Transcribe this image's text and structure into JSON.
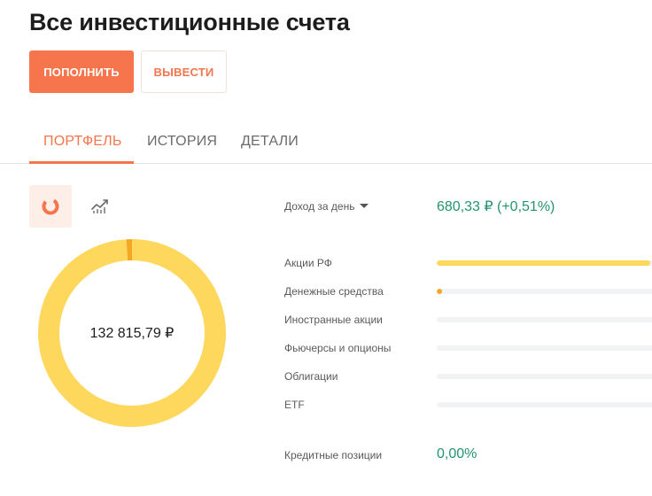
{
  "header": {
    "title": "Все инвестиционные счета"
  },
  "actions": {
    "deposit_label": "ПОПОЛНИТЬ",
    "withdraw_label": "ВЫВЕСТИ"
  },
  "tabs": [
    {
      "label": "ПОРТФЕЛЬ",
      "active": true
    },
    {
      "label": "ИСТОРИЯ",
      "active": false
    },
    {
      "label": "ДЕТАЛИ",
      "active": false
    }
  ],
  "view_toggles": [
    {
      "icon": "donut-chart-icon",
      "active": true
    },
    {
      "icon": "line-chart-icon",
      "active": false
    }
  ],
  "portfolio": {
    "total": "132 815,79 ₽"
  },
  "daily_income": {
    "label": "Доход за день",
    "value": "680,33 ₽ (+0,51%)"
  },
  "allocation": [
    {
      "label": "Акции РФ",
      "share": 0.99,
      "color": "#fdd85d"
    },
    {
      "label": "Денежные средства",
      "share": 0.01,
      "color": "#f5a623"
    },
    {
      "label": "Иностранные акции",
      "share": 0,
      "color": "#fdd85d"
    },
    {
      "label": "Фьючерсы и опционы",
      "share": 0,
      "color": "#fdd85d"
    },
    {
      "label": "Облигации",
      "share": 0,
      "color": "#fdd85d"
    },
    {
      "label": "ETF",
      "share": 0,
      "color": "#fdd85d"
    }
  ],
  "credit": {
    "label": "Кредитные позиции",
    "value": "0,00%"
  },
  "colors": {
    "accent": "#f7754c",
    "positive": "#23946b",
    "donut_main": "#fdd85d",
    "donut_secondary": "#f5a623"
  }
}
